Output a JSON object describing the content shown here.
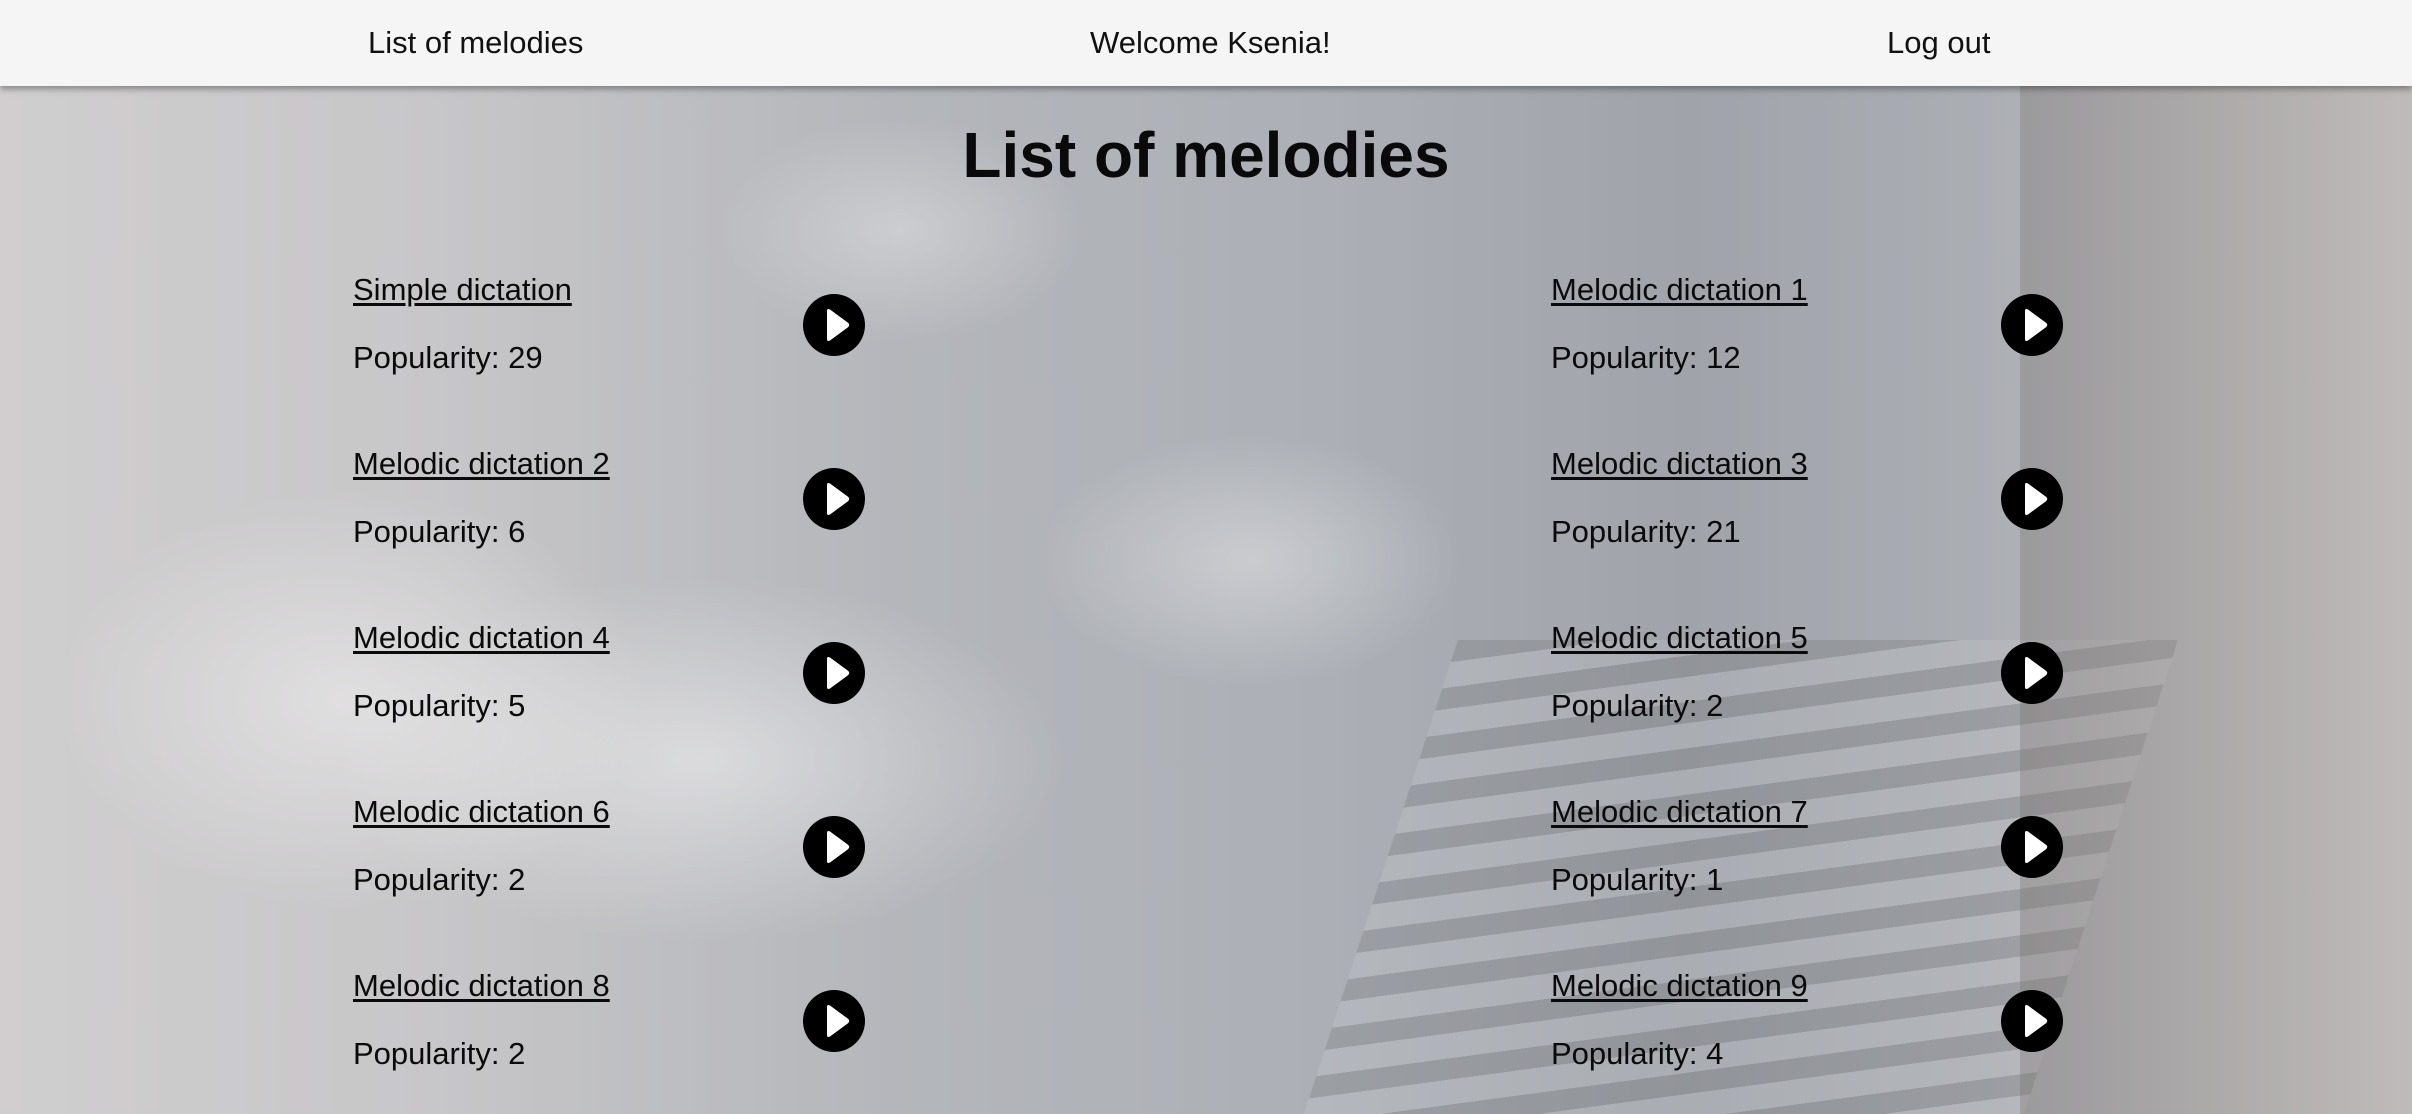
{
  "navbar": {
    "list_link": "List of melodies",
    "welcome": "Welcome Ksenia!",
    "logout": "Log out"
  },
  "main": {
    "title": "List of melodies",
    "melodies": [
      {
        "name": "Simple dictation",
        "popularity": "Popularity: 29"
      },
      {
        "name": "Melodic dictation 1",
        "popularity": "Popularity: 12"
      },
      {
        "name": "Melodic dictation 2",
        "popularity": "Popularity: 6"
      },
      {
        "name": "Melodic dictation 3",
        "popularity": "Popularity: 21"
      },
      {
        "name": "Melodic dictation 4",
        "popularity": "Popularity: 5"
      },
      {
        "name": "Melodic dictation 5",
        "popularity": "Popularity: 2"
      },
      {
        "name": "Melodic dictation 6",
        "popularity": "Popularity: 2"
      },
      {
        "name": "Melodic dictation 7",
        "popularity": "Popularity: 1"
      },
      {
        "name": "Melodic dictation 8",
        "popularity": "Popularity: 2"
      },
      {
        "name": "Melodic dictation 9",
        "popularity": "Popularity: 4"
      }
    ],
    "play_icon": "play-icon"
  },
  "colors": {
    "navbar_bg": "#f5f5f5",
    "text": "#0a0a0a",
    "play_button": "#000000"
  }
}
